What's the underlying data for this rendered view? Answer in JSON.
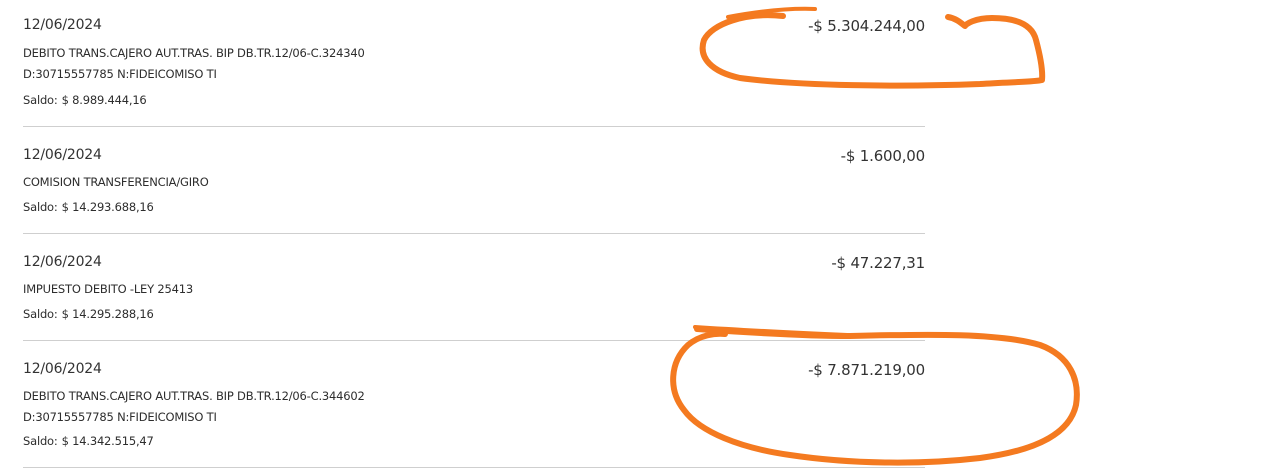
{
  "transactions": [
    {
      "date": "12/06/2024",
      "description": [
        "DEBITO TRANS.CAJERO AUT.TRAS. BIP DB.TR.12/06-C.324340",
        "D:30715557785 N:FIDEICOMISO TI"
      ],
      "amount": "-$ 5.304.244,00",
      "saldo_label": "Saldo:",
      "saldo": "$ 8.989.444,16"
    },
    {
      "date": "12/06/2024",
      "description": [
        "COMISION TRANSFERENCIA/GIRO"
      ],
      "amount": "-$ 1.600,00",
      "saldo_label": "Saldo:",
      "saldo": "$ 14.293.688,16"
    },
    {
      "date": "12/06/2024",
      "description": [
        "IMPUESTO DEBITO -LEY 25413"
      ],
      "amount": "-$ 47.227,31",
      "saldo_label": "Saldo:",
      "saldo": "$ 14.295.288,16"
    },
    {
      "date": "12/06/2024",
      "description": [
        "DEBITO TRANS.CAJERO AUT.TRAS. BIP DB.TR.12/06-C.344602",
        "D:30715557785 N:FIDEICOMISO TI"
      ],
      "amount": "-$ 7.871.219,00",
      "saldo_label": "Saldo:",
      "saldo": "$ 14.342.515,47"
    }
  ],
  "annotation": {
    "color": "#F47A20"
  }
}
